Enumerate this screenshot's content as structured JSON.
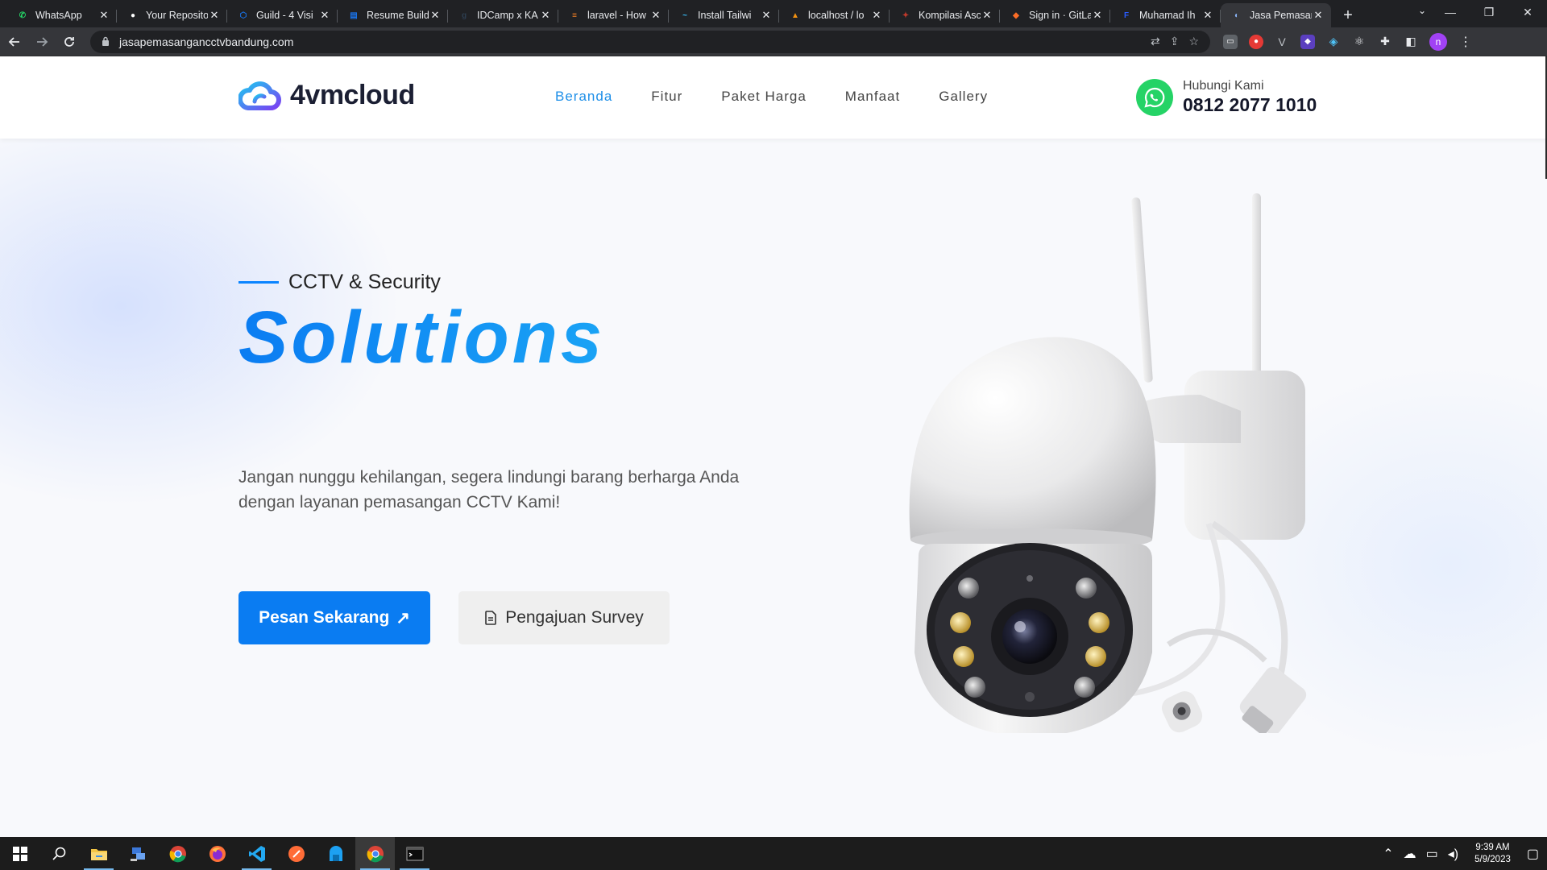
{
  "browser": {
    "tabs": [
      {
        "title": "WhatsApp",
        "favicon": "whatsapp-icon",
        "color": "#25d366",
        "glyph": "✆"
      },
      {
        "title": "Your Reposito",
        "favicon": "github-icon",
        "color": "#ffffff",
        "glyph": "●"
      },
      {
        "title": "Guild - 4 Visi",
        "favicon": "guild-icon",
        "color": "#1a73e8",
        "glyph": "⬡"
      },
      {
        "title": "Resume Build",
        "favicon": "resume-icon",
        "color": "#1a73e8",
        "glyph": "▤"
      },
      {
        "title": "IDCamp x KA",
        "favicon": "dicoding-icon",
        "color": "#2d3e50",
        "glyph": "g"
      },
      {
        "title": "laravel - How",
        "favicon": "stackoverflow-icon",
        "color": "#f48024",
        "glyph": "≡"
      },
      {
        "title": "Install Tailwi",
        "favicon": "tailwind-icon",
        "color": "#38bdf8",
        "glyph": "~"
      },
      {
        "title": "localhost / lo",
        "favicon": "phpmyadmin-icon",
        "color": "#f29111",
        "glyph": "▲"
      },
      {
        "title": "Kompilasi Asc",
        "favicon": "kompilasi-icon",
        "color": "#c0392b",
        "glyph": "✦"
      },
      {
        "title": "Sign in · GitLa",
        "favicon": "gitlab-icon",
        "color": "#fc6d26",
        "glyph": "◆"
      },
      {
        "title": "Muhamad Ih",
        "favicon": "f-icon",
        "color": "#2a5cff",
        "glyph": "F"
      },
      {
        "title": "Jasa Pemasan",
        "favicon": "site-icon",
        "color": "#8ab4f8",
        "glyph": "◐",
        "active": true
      }
    ],
    "url": "jasapemasangancctvbandung.com"
  },
  "header": {
    "logo_text": "4vmcloud",
    "nav": [
      "Beranda",
      "Fitur",
      "Paket Harga",
      "Manfaat",
      "Gallery"
    ],
    "active_nav": "Beranda",
    "contact_label": "Hubungi Kami",
    "contact_phone": "0812 2077 1010"
  },
  "hero": {
    "eyebrow": "CCTV & Security",
    "title": "Solutions",
    "description": "Jangan nunggu kehilangan, segera lindungi barang berharga Anda dengan layanan pemasangan CCTV Kami!",
    "primary_button": "Pesan Sekarang",
    "primary_arrow": "↗",
    "secondary_button": "Pengajuan Survey"
  },
  "colors": {
    "accent": "#0a7cf2",
    "whatsapp": "#25d366",
    "nav_active": "#1e8fe8"
  },
  "taskbar": {
    "apps": [
      "start-icon",
      "search-icon",
      "file-explorer-icon",
      "network-icon",
      "chrome-icon",
      "firefox-icon",
      "vscode-icon",
      "postman-icon",
      "app-icon",
      "chrome-icon",
      "terminal-icon"
    ],
    "time": "9:39 AM",
    "date": "5/9/2023"
  }
}
